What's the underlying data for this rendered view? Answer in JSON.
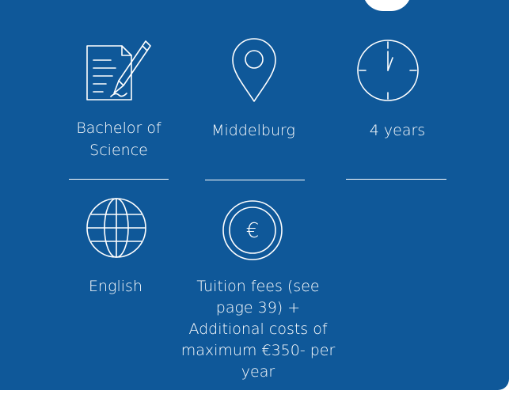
{
  "facts": {
    "degree": {
      "icon": "document-pen-icon",
      "label": "Bachelor of Science"
    },
    "location": {
      "icon": "map-pin-icon",
      "label": "Middelburg"
    },
    "duration": {
      "icon": "clock-icon",
      "label": "4 years"
    },
    "language": {
      "icon": "globe-icon",
      "label": "English"
    },
    "costs": {
      "icon": "euro-coin-icon",
      "icon_text": "€",
      "label": "Tuition fees (see page 39) + Additional costs of maximum €350- per year"
    }
  },
  "colors": {
    "background": "#0f5899",
    "foreground": "#ffffff"
  }
}
